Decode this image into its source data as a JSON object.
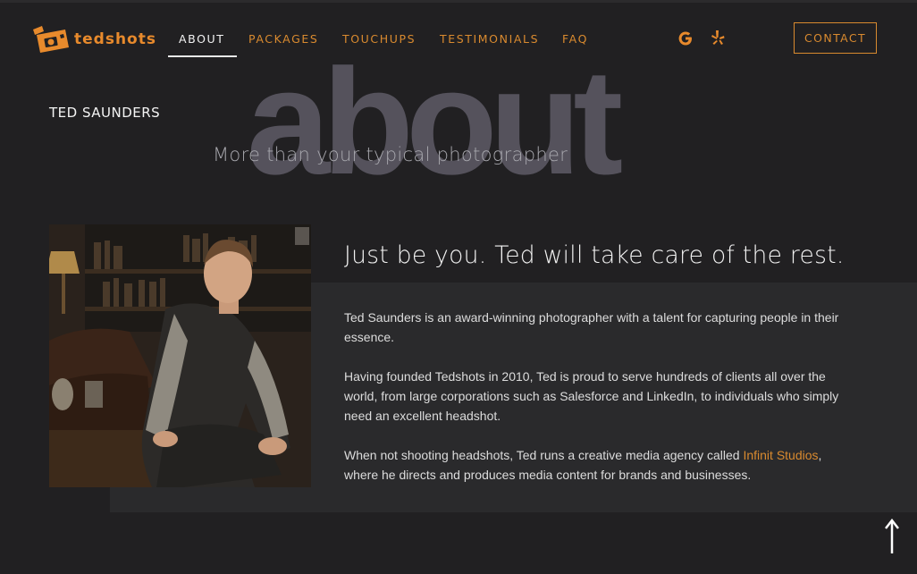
{
  "brand": {
    "name": "tedshots",
    "accent": "#d98a2f"
  },
  "nav": {
    "items": [
      {
        "label": "ABOUT",
        "active": true
      },
      {
        "label": "PACKAGES"
      },
      {
        "label": "TOUCHUPS"
      },
      {
        "label": "TESTIMONIALS"
      },
      {
        "label": "FAQ"
      }
    ],
    "social": [
      "google-icon",
      "yelp-icon"
    ],
    "contact_label": "CONTACT"
  },
  "hero": {
    "background_word": "about",
    "name": "TED SAUNDERS",
    "tagline": "More than your typical photographer"
  },
  "content": {
    "headline": "Just be you. Ted will take care of the rest.",
    "p1": "Ted Saunders is an award-winning photographer with a talent for capturing people in their essence.",
    "p2": "Having founded Tedshots in 2010, Ted is proud to serve hundreds of clients all over the world, from large corporations such as Salesforce and LinkedIn, to individuals who simply need an excellent headshot.",
    "p3_before": "When not shooting headshots, Ted runs a creative media agency called ",
    "p3_link": "Infinit Studios",
    "p3_after": ", where he directs and produces media content for brands and businesses."
  },
  "scroll_top_icon": "arrow-up-icon"
}
